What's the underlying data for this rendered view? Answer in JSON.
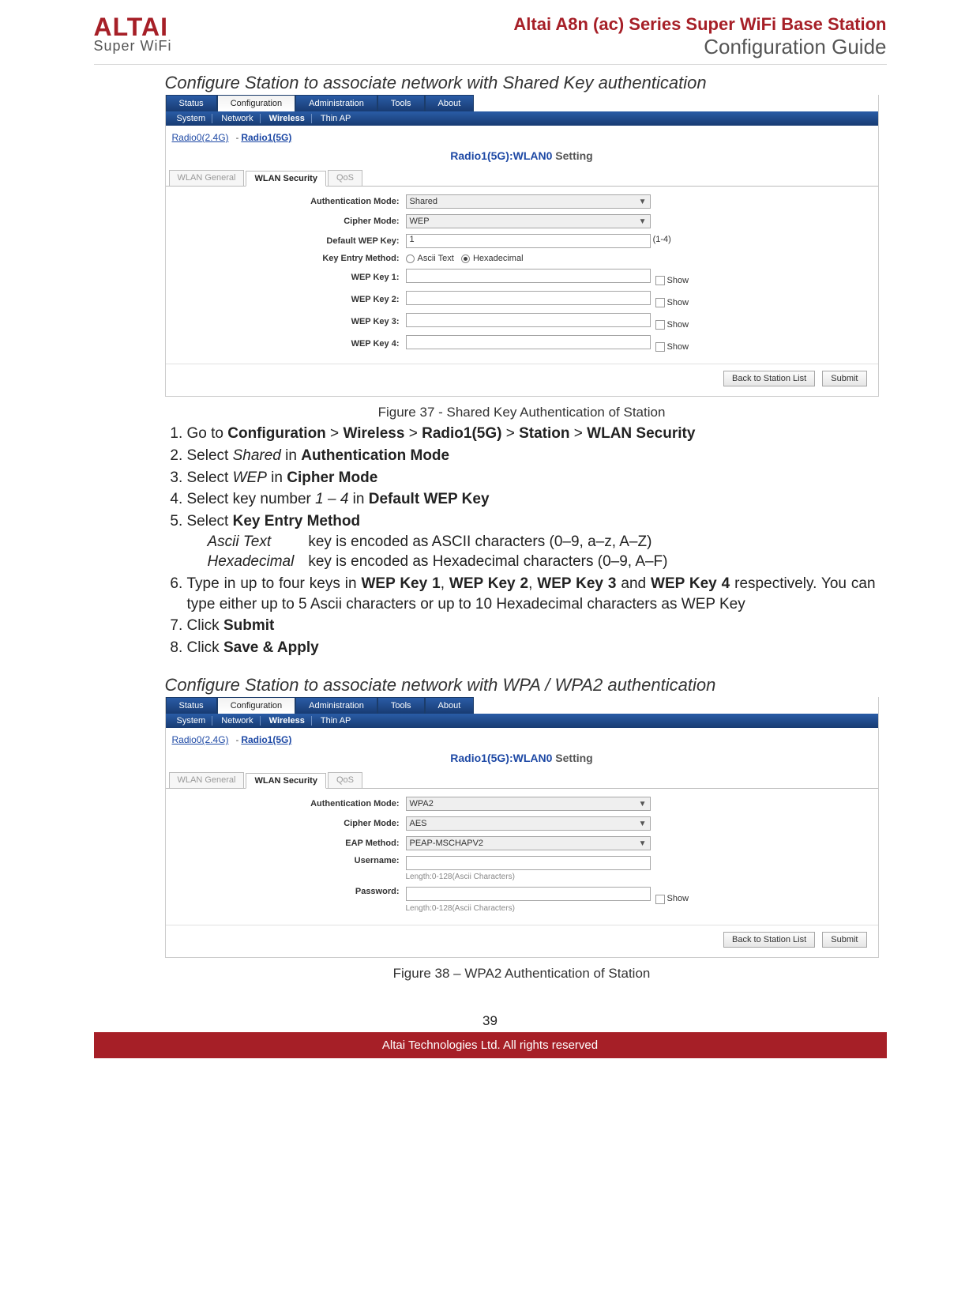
{
  "header": {
    "logo_top": "ALTAI",
    "logo_sub": "Super WiFi",
    "product": "Altai A8n (ac) Series Super WiFi Base Station",
    "guide": "Configuration Guide"
  },
  "section1": {
    "title": "Configure Station to associate network with Shared Key authentication",
    "caption": "Figure 37 - Shared Key Authentication of Station",
    "shot": {
      "tabs": [
        "Status",
        "Configuration",
        "Administration",
        "Tools",
        "About"
      ],
      "active_tab": "Configuration",
      "subnav": [
        "System",
        "Network",
        "Wireless",
        "Thin AP"
      ],
      "subnav_active": "Wireless",
      "radio_links": {
        "r0": "Radio0(2.4G)",
        "sep": "-",
        "r1": "Radio1(5G)"
      },
      "panel_title": {
        "p1": "Radio1(5G):",
        "p2": "WLAN0",
        "p3": " Setting"
      },
      "subtabs": [
        "WLAN General",
        "WLAN Security",
        "QoS"
      ],
      "subtab_active": "WLAN Security",
      "rows": {
        "auth_lbl": "Authentication Mode:",
        "auth_val": "Shared",
        "cipher_lbl": "Cipher Mode:",
        "cipher_val": "WEP",
        "defkey_lbl": "Default WEP Key:",
        "defkey_val": "1",
        "defkey_hint": "(1-4)",
        "method_lbl": "Key Entry Method:",
        "method_opt1": "Ascii Text",
        "method_opt2": "Hexadecimal",
        "k1": "WEP Key 1:",
        "k2": "WEP Key 2:",
        "k3": "WEP Key 3:",
        "k4": "WEP Key 4:",
        "show": "Show"
      },
      "btn_back": "Back to Station List",
      "btn_submit": "Submit"
    },
    "steps": {
      "s1a": "Go to ",
      "s1b": "Configuration",
      "s1c": " > ",
      "s1d": "Wireless",
      "s1e": " > ",
      "s1f": "Radio1(5G)",
      "s1g": " > ",
      "s1h": "Station",
      "s1i": " > ",
      "s1j": "WLAN Security",
      "s2a": "Select ",
      "s2b": "Shared",
      "s2c": " in ",
      "s2d": "Authentication Mode",
      "s3a": "Select ",
      "s3b": "WEP",
      "s3c": " in ",
      "s3d": "Cipher Mode",
      "s4a": "Select key number ",
      "s4b": "1 – 4",
      "s4c": " in ",
      "s4d": "Default WEP Key",
      "s5a": "Select ",
      "s5b": "Key Entry Method",
      "s5_opt1_l": "Ascii Text",
      "s5_opt1_r": "key is encoded as ASCII characters (0–9, a–z, A–Z)",
      "s5_opt2_l": "Hexadecimal",
      "s5_opt2_r": "key is encoded as Hexadecimal characters (0–9, A–F)",
      "s6a": "Type in up to four keys in ",
      "s6b": "WEP Key 1",
      "s6c": ", ",
      "s6d": "WEP Key 2",
      "s6e": ", ",
      "s6f": "WEP Key 3",
      "s6g": " and ",
      "s6h": "WEP Key 4",
      "s6i": " respectively. You can type either up to 5 Ascii characters or up to 10 Hexadecimal characters as WEP Key",
      "s7a": "Click ",
      "s7b": "Submit",
      "s8a": "Click ",
      "s8b": "Save & Apply"
    }
  },
  "section2": {
    "title": "Configure Station to associate network with WPA / WPA2 authentication",
    "caption": "Figure 38 – WPA2 Authentication of Station",
    "shot": {
      "rows": {
        "auth_lbl": "Authentication Mode:",
        "auth_val": "WPA2",
        "cipher_lbl": "Cipher Mode:",
        "cipher_val": "AES",
        "eap_lbl": "EAP Method:",
        "eap_val": "PEAP-MSCHAPV2",
        "user_lbl": "Username:",
        "user_hint": "Length:0-128(Ascii Characters)",
        "pass_lbl": "Password:",
        "pass_hint": "Length:0-128(Ascii Characters)",
        "show": "Show"
      }
    }
  },
  "page_num": "39",
  "footer": "Altai Technologies Ltd. All rights reserved"
}
